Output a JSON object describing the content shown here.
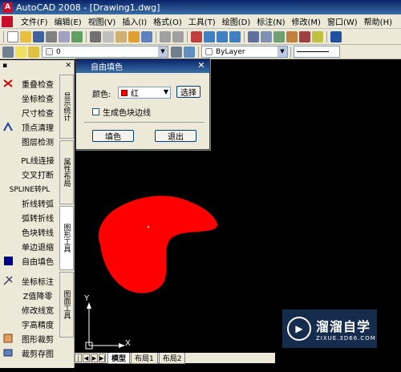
{
  "window": {
    "title": "AutoCAD 2008 - [Drawing1.dwg]"
  },
  "menubar": [
    "文件(F)",
    "编辑(E)",
    "视图(V)",
    "插入(I)",
    "格式(O)",
    "工具(T)",
    "绘图(D)",
    "标注(N)",
    "修改(M)",
    "窗口(W)",
    "帮助(H)"
  ],
  "toolbar2": {
    "layer_value": "0",
    "bylayer_value": "ByLayer"
  },
  "left_panel": {
    "items": [
      {
        "label": "重叠检查",
        "icon": "overlap-check-icon"
      },
      {
        "label": "坐标检查",
        "icon": ""
      },
      {
        "label": "尺寸检查",
        "icon": ""
      },
      {
        "label": "顶点清理",
        "icon": "vertex-clean-icon"
      },
      {
        "label": "图层检测",
        "icon": ""
      },
      {
        "label": "PL线连接",
        "icon": ""
      },
      {
        "label": "交叉打断",
        "icon": ""
      },
      {
        "label": "SPLINE转PL",
        "icon": ""
      },
      {
        "label": "折线转弧",
        "icon": ""
      },
      {
        "label": "弧转折线",
        "icon": ""
      },
      {
        "label": "色块转线",
        "icon": ""
      },
      {
        "label": "单边退缩",
        "icon": ""
      },
      {
        "label": "自由填色",
        "icon": "fill-color-icon"
      },
      {
        "label": "坐标标注",
        "icon": "coord-annotate-icon"
      },
      {
        "label": "Z值降零",
        "icon": ""
      },
      {
        "label": "修改线宽",
        "icon": ""
      },
      {
        "label": "字高精度",
        "icon": ""
      },
      {
        "label": "图形裁剪",
        "icon": "shape-clip-icon"
      },
      {
        "label": "裁剪存图",
        "icon": "clip-save-icon"
      }
    ],
    "vtabs": [
      "显示统计",
      "属性布局",
      "图形工具",
      "图面工具"
    ]
  },
  "dialog": {
    "title": "自由填色",
    "color_label": "颜色:",
    "color_value": "红",
    "choose_button": "选择",
    "checkbox_label": "生成色块边线",
    "fill_button": "填色",
    "exit_button": "退出"
  },
  "ucs": {
    "x_label": "X",
    "y_label": "Y"
  },
  "layout_tabs": [
    "模型",
    "布局1",
    "布局2"
  ],
  "watermark": {
    "brand": "溜溜自学",
    "site": "ZIXUE.3D66.COM"
  },
  "colors": {
    "fill": "#ff0000",
    "title_bar": "#0a246a"
  }
}
